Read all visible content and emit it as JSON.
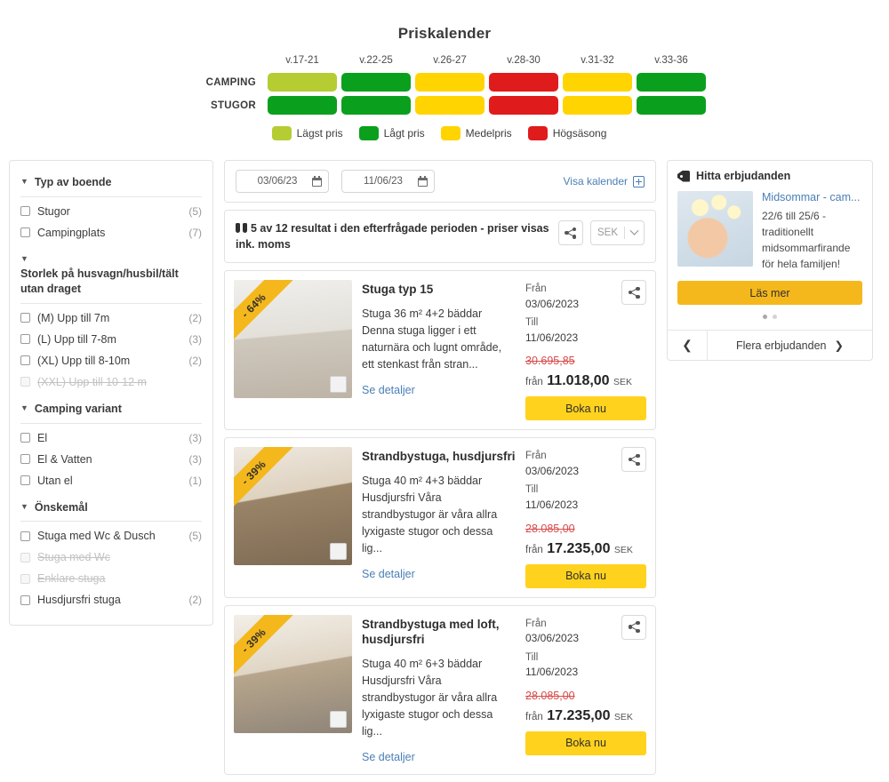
{
  "calendar": {
    "title": "Priskalender",
    "weeks": [
      "v.17-21",
      "v.22-25",
      "v.26-27",
      "v.28-30",
      "v.31-32",
      "v.33-36"
    ],
    "rows": [
      {
        "label": "CAMPING",
        "levels": [
          "lowest",
          "low",
          "medium",
          "high",
          "medium",
          "low"
        ]
      },
      {
        "label": "STUGOR",
        "levels": [
          "low",
          "low",
          "medium",
          "high",
          "medium",
          "low"
        ]
      }
    ],
    "legend": [
      {
        "key": "lowest",
        "label": "Lägst pris",
        "color": "#b5cc33"
      },
      {
        "key": "low",
        "label": "Lågt pris",
        "color": "#0aa01e"
      },
      {
        "key": "medium",
        "label": "Medelpris",
        "color": "#ffd400"
      },
      {
        "key": "high",
        "label": "Högsäsong",
        "color": "#e01b1b"
      }
    ],
    "colors": {
      "lowest": "#b5cc33",
      "low": "#0aa01e",
      "medium": "#ffd400",
      "high": "#e01b1b"
    }
  },
  "sidebar": {
    "groups": [
      {
        "title": "Typ av boende",
        "wrapped": false,
        "options": [
          {
            "label": "Stugor",
            "count": "(5)",
            "disabled": false
          },
          {
            "label": "Campingplats",
            "count": "(7)",
            "disabled": false
          }
        ]
      },
      {
        "title": "Storlek på husvagn/husbil/tält utan draget",
        "wrapped": true,
        "options": [
          {
            "label": "(M) Upp till 7m",
            "count": "(2)",
            "disabled": false
          },
          {
            "label": "(L) Upp till 7-8m",
            "count": "(3)",
            "disabled": false
          },
          {
            "label": "(XL) Upp till 8-10m",
            "count": "(2)",
            "disabled": false
          },
          {
            "label": "(XXL) Upp till 10-12 m",
            "count": "",
            "disabled": true
          }
        ]
      },
      {
        "title": "Camping variant",
        "wrapped": false,
        "options": [
          {
            "label": "El",
            "count": "(3)",
            "disabled": false
          },
          {
            "label": "El & Vatten",
            "count": "(3)",
            "disabled": false
          },
          {
            "label": "Utan el",
            "count": "(1)",
            "disabled": false
          }
        ]
      },
      {
        "title": "Önskemål",
        "wrapped": false,
        "options": [
          {
            "label": "Stuga med Wc & Dusch",
            "count": "(5)",
            "disabled": false
          },
          {
            "label": "Stuga med Wc",
            "count": "",
            "disabled": true
          },
          {
            "label": "Enklare stuga",
            "count": "",
            "disabled": true
          },
          {
            "label": "Husdjursfri stuga",
            "count": "(2)",
            "disabled": false
          }
        ]
      }
    ]
  },
  "search": {
    "date_from": "03/06/23",
    "date_to": "11/06/23",
    "show_calendar_label": "Visa kalender",
    "results_text": "5 av 12 resultat i den efterfrågade perioden - priser visas ink. moms",
    "currency": "SEK"
  },
  "results": [
    {
      "discount": "- 64%",
      "title": "Stuga typ 15",
      "desc": "Stuga 36 m² 4+2 bäddar Denna stuga ligger i ett naturnära och lugnt område, ett stenkast från stran...",
      "details_label": "Se detaljer",
      "from_label": "Från",
      "from_date": "03/06/2023",
      "to_label": "Till",
      "to_date": "11/06/2023",
      "old_price": "30.695,85",
      "price_prefix": "från",
      "price": "11.018,00",
      "currency": "SEK",
      "book_label": "Boka nu"
    },
    {
      "discount": "- 39%",
      "title": "Strandbystuga, husdjursfri",
      "desc": "Stuga 40 m² 4+3 bäddar Husdjursfri Våra strandbystugor är våra allra lyxigaste stugor och dessa lig...",
      "details_label": "Se detaljer",
      "from_label": "Från",
      "from_date": "03/06/2023",
      "to_label": "Till",
      "to_date": "11/06/2023",
      "old_price": "28.085,00",
      "price_prefix": "från",
      "price": "17.235,00",
      "currency": "SEK",
      "book_label": "Boka nu"
    },
    {
      "discount": "- 39%",
      "title": "Strandbystuga med loft, husdjursfri",
      "desc": "Stuga 40 m² 6+3 bäddar Husdjursfri Våra strandbystugor är våra allra lyxigaste stugor och dessa lig...",
      "details_label": "Se detaljer",
      "from_label": "Från",
      "from_date": "03/06/2023",
      "to_label": "Till",
      "to_date": "11/06/2023",
      "old_price": "28.085,00",
      "price_prefix": "från",
      "price": "17.235,00",
      "currency": "SEK",
      "book_label": "Boka nu"
    }
  ],
  "offers": {
    "heading": "Hitta erbjudanden",
    "item": {
      "title": "Midsommar - cam...",
      "desc": "22/6 till 25/6 - traditionellt midsommarfirande för hela familjen!",
      "cta": "Läs mer"
    },
    "more_label": "Flera erbjudanden"
  }
}
